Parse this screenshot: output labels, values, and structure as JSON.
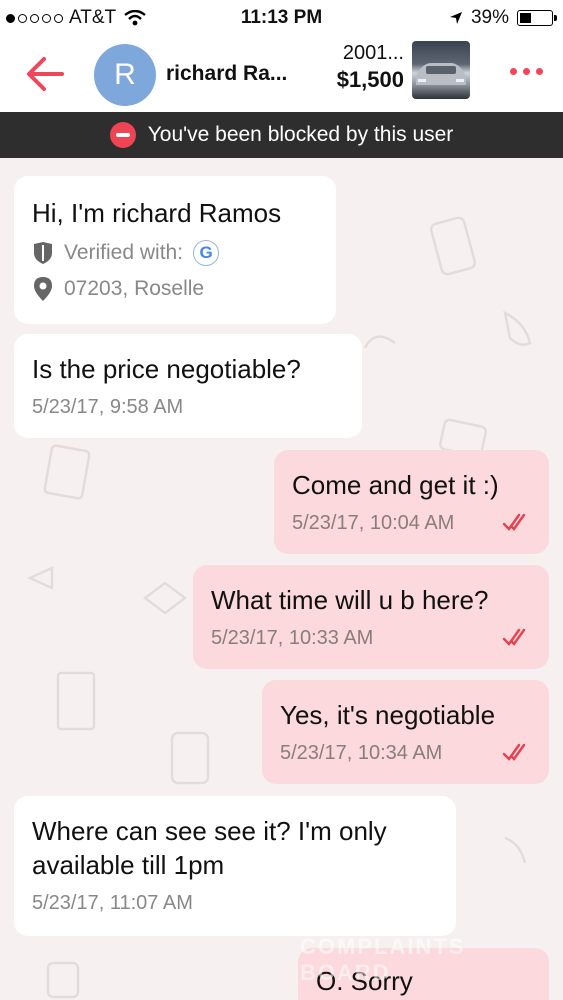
{
  "status_bar": {
    "carrier": "AT&T",
    "time": "11:13 PM",
    "battery": "39%",
    "battery_level": 0.39
  },
  "header": {
    "avatar_letter": "R",
    "contact_name": "richard Ra...",
    "listing_title": "2001...",
    "listing_price": "$1,500",
    "accent_color": "#f0455a"
  },
  "banner": {
    "text": "You've been blocked by this user"
  },
  "profile_card": {
    "greeting": "Hi, I'm richard Ramos",
    "verified_label": "Verified with:",
    "verified_provider": "G",
    "location": "07203, Roselle"
  },
  "messages": [
    {
      "direction": "in",
      "text": "Is the price negotiable?",
      "time": "5/23/17, 9:58 AM"
    },
    {
      "direction": "out",
      "text": "Come and get it :)",
      "time": "5/23/17, 10:04 AM",
      "read": true
    },
    {
      "direction": "out",
      "text": "What time will u b here?",
      "time": "5/23/17, 10:33 AM",
      "read": true
    },
    {
      "direction": "out",
      "text": "Yes, it's negotiable",
      "time": "5/23/17, 10:34 AM",
      "read": true
    },
    {
      "direction": "in",
      "text": "Where can see see it? I'm only available till 1pm",
      "time": "5/23/17, 11:07 AM"
    },
    {
      "direction": "out",
      "text": "O. Sorry",
      "time": ""
    }
  ],
  "watermark": {
    "line1": "COMPLAINTS",
    "line2": "BOARD"
  }
}
